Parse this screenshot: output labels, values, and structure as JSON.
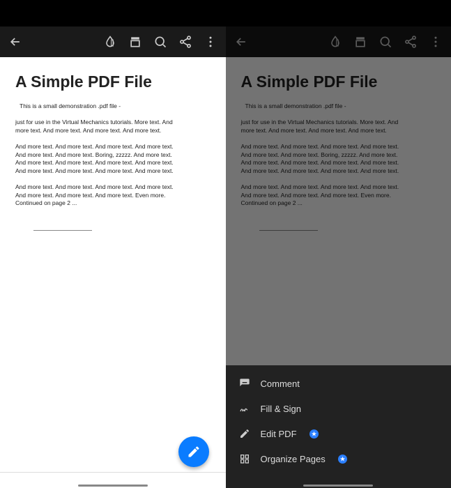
{
  "document": {
    "title": "A Simple PDF File",
    "p1": "This is a small demonstration .pdf file -",
    "p2": "just for use in the Virtual Mechanics tutorials. More text. And more text. And more text. And more text. And more text.",
    "p3": "And more text. And more text. And more text. And more text. And more text. And more text. Boring, zzzzz. And more text. And more text. And more text. And more text. And more text. And more text. And more text. And more text. And more text.",
    "p4": "And more text. And more text. And more text. And more text. And more text. And more text. And more text. Even more. Continued on page 2 ..."
  },
  "sheet": {
    "comment": "Comment",
    "fill_sign": "Fill & Sign",
    "edit_pdf": "Edit PDF",
    "organize": "Organize Pages"
  }
}
